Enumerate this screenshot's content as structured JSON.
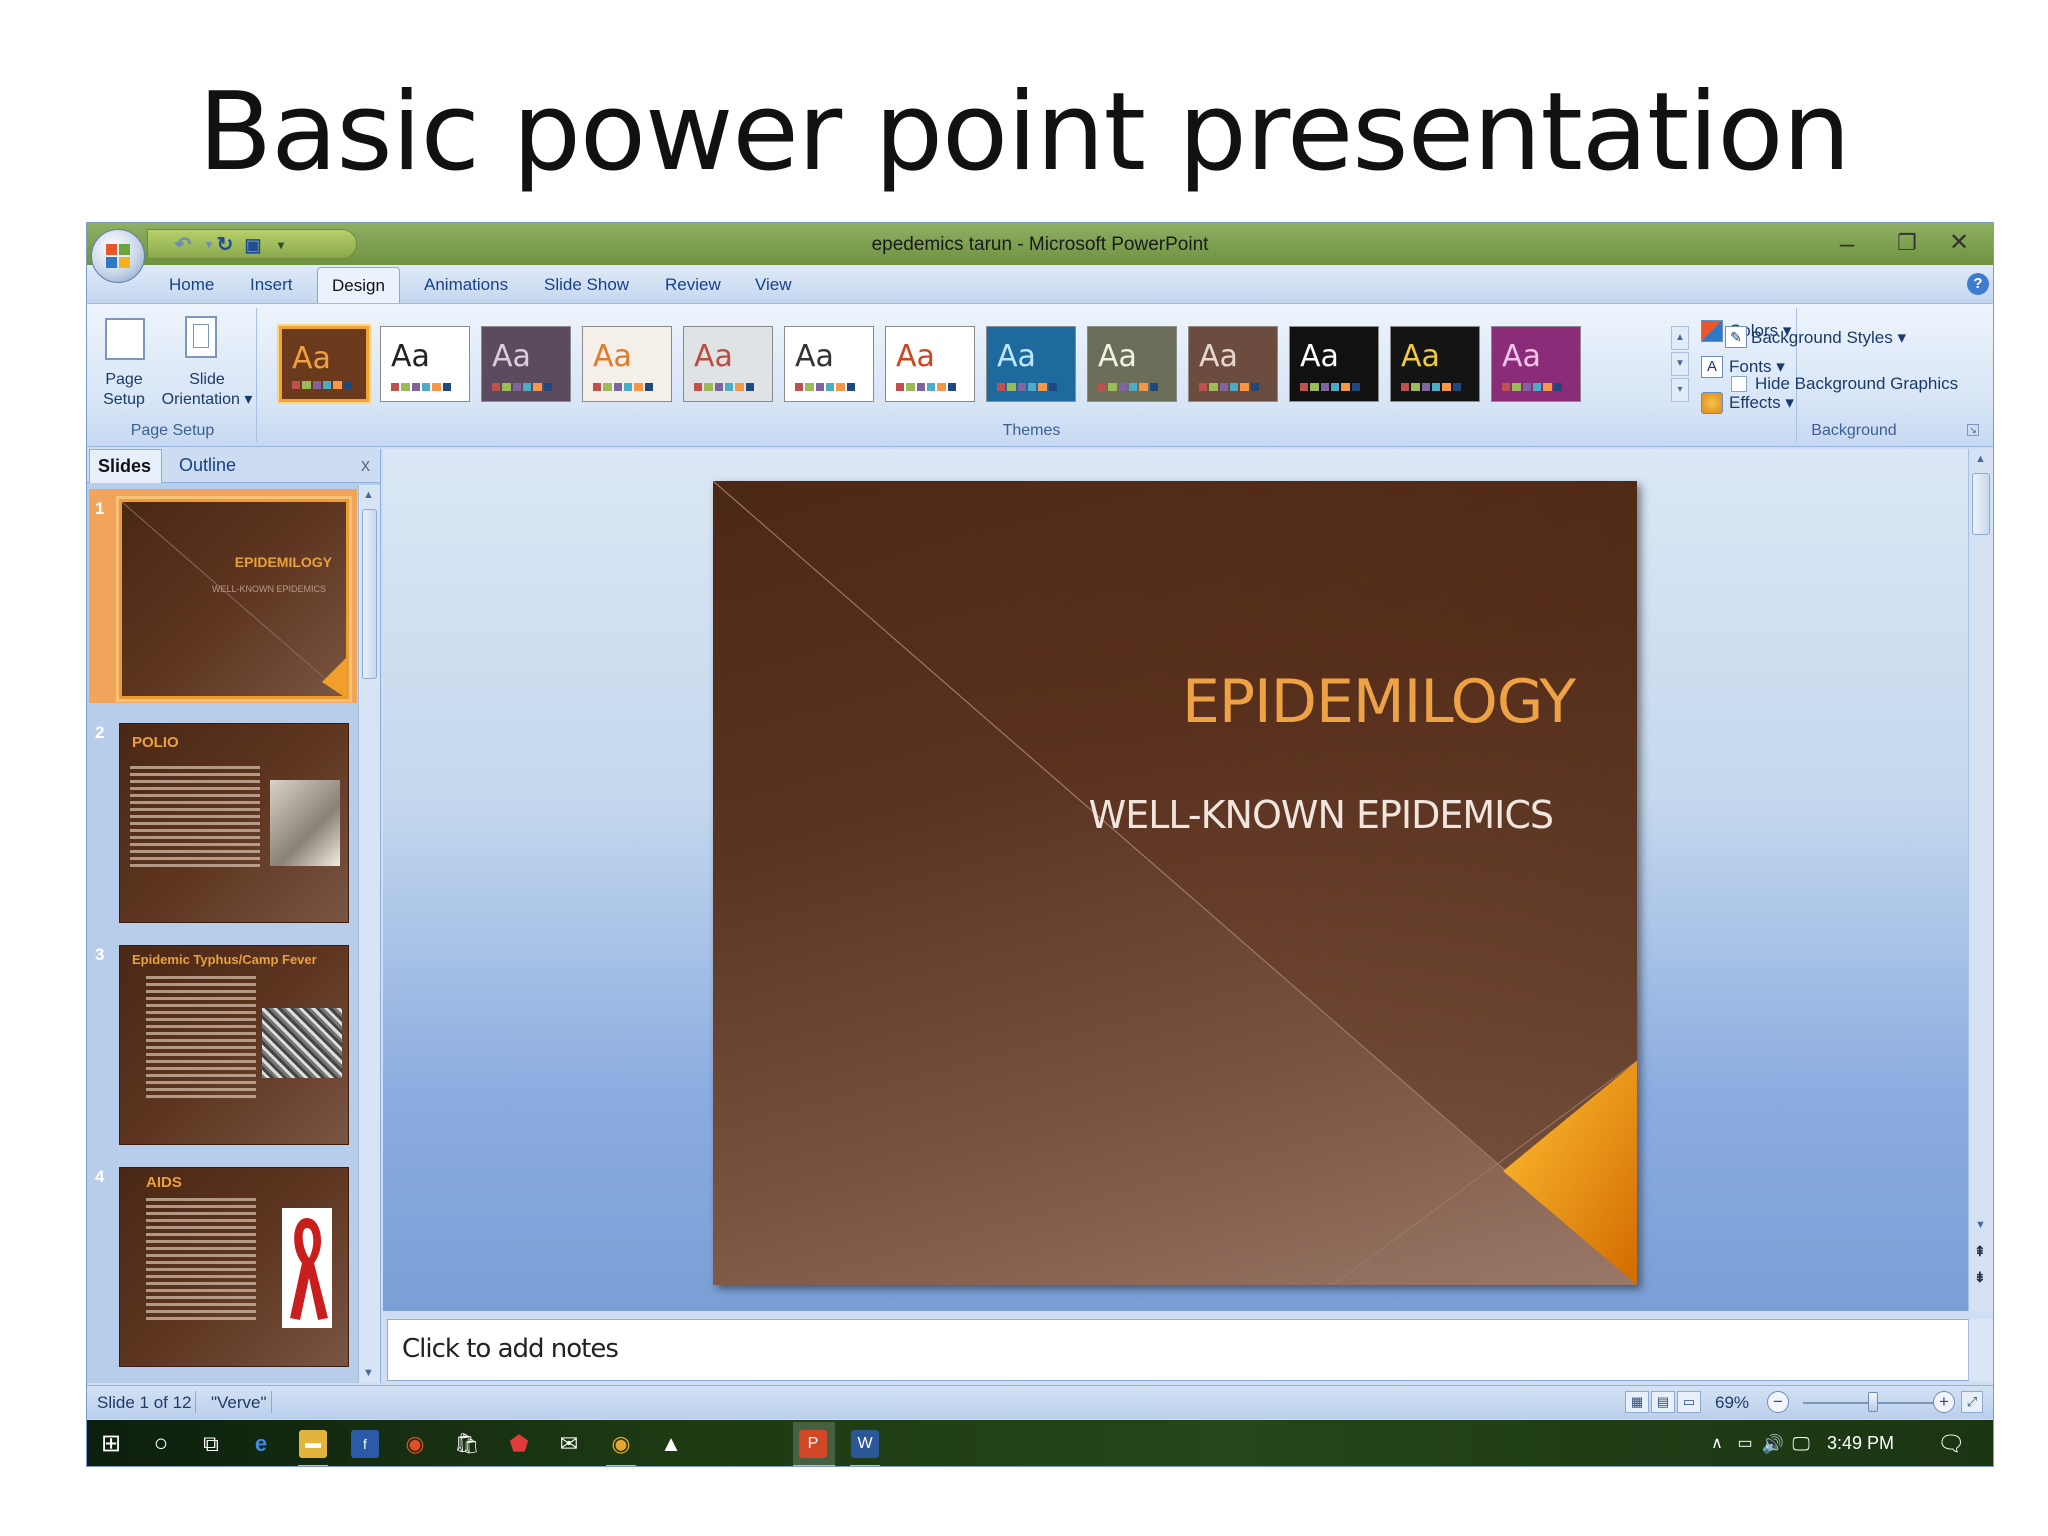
{
  "heading": "Basic power point presentation",
  "window": {
    "title": "epedemics tarun - Microsoft PowerPoint",
    "controls": {
      "minimize": "–",
      "restore": "❐",
      "close": "✕"
    }
  },
  "tabs": [
    "Home",
    "Insert",
    "Design",
    "Animations",
    "Slide Show",
    "Review",
    "View"
  ],
  "active_tab": "Design",
  "ribbon": {
    "page_setup": {
      "label": "Page Setup",
      "page_setup_button": {
        "line1": "Page",
        "line2": "Setup"
      },
      "orientation_button": {
        "line1": "Slide",
        "line2": "Orientation ▾"
      }
    },
    "themes": {
      "label": "Themes",
      "thumb_text": "Aa",
      "items": [
        {
          "bg": "#6b3a1c",
          "fg": "#f0a040",
          "selected": true
        },
        {
          "bg": "#ffffff",
          "fg": "#222222"
        },
        {
          "bg": "#5c4a5e",
          "fg": "#d9cde0"
        },
        {
          "bg": "#f4efe8",
          "fg": "#e07a2a"
        },
        {
          "bg": "#dfe3e6",
          "fg": "#b84d40"
        },
        {
          "bg": "#ffffff",
          "fg": "#333333"
        },
        {
          "bg": "#ffffff",
          "fg": "#d0431e"
        },
        {
          "bg": "#1e6a9e",
          "fg": "#bfe6ff"
        },
        {
          "bg": "#6c6e5a",
          "fg": "#f1f1e4"
        },
        {
          "bg": "#6b4c3f",
          "fg": "#e6d8cf"
        },
        {
          "bg": "#111111",
          "fg": "#ffffff"
        },
        {
          "bg": "#141414",
          "fg": "#f2c93a"
        },
        {
          "bg": "#8b2c78",
          "fg": "#f0c4e8"
        }
      ],
      "colors": "Colors ▾",
      "fonts": "Fonts ▾",
      "effects": "Effects ▾"
    },
    "background": {
      "label": "Background",
      "styles": "Background Styles ▾",
      "hide_graphics": "Hide Background Graphics"
    }
  },
  "left_pane": {
    "tabs": [
      "Slides",
      "Outline"
    ],
    "close": "x",
    "slides": [
      {
        "num": "1",
        "title": "EPIDEMILOGY",
        "subtitle": "WELL-KNOWN EPIDEMICS"
      },
      {
        "num": "2",
        "title": "POLIO"
      },
      {
        "num": "3",
        "title": "Epidemic Typhus/Camp Fever"
      },
      {
        "num": "4",
        "title": "AIDS"
      }
    ]
  },
  "slide": {
    "title": "EPIDEMILOGY",
    "subtitle": "WELL-KNOWN EPIDEMICS"
  },
  "notes_placeholder": "Click to add notes",
  "status": {
    "slide_of": "Slide 1 of 12",
    "theme": "\"Verve\"",
    "zoom": "69%",
    "zoom_fraction": 0.69
  },
  "taskbar": {
    "time": "3:49 PM"
  }
}
